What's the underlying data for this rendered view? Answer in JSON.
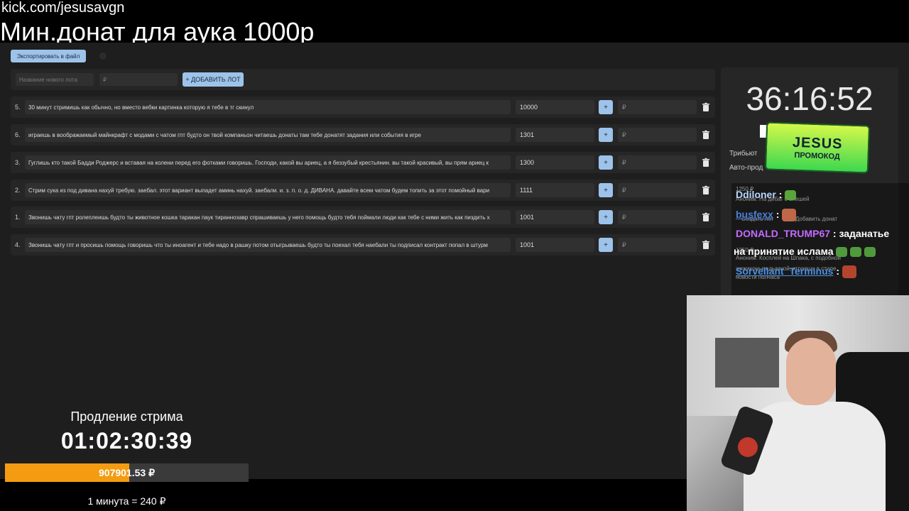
{
  "overlay": {
    "url": "kick.com/jesusavgn",
    "title": "Мин.донат для аука 1000р"
  },
  "toolbar": {
    "export_label": "Экспортировать в файл"
  },
  "new_lot": {
    "name_placeholder": "Название нового лота",
    "amount_placeholder": "₽",
    "add_label": "+ ДОБАВИТЬ ЛОТ"
  },
  "lots": [
    {
      "num": "5.",
      "name": "30 минут стримишь как обычно, но вместо вебки картинка которую я тебе в тг скинул",
      "amount": "10000",
      "plus": "+",
      "rub": "₽"
    },
    {
      "num": "6.",
      "name": "играешь в воображаемый майнкрафт с модами с чатом гпт будто он твой компаньон читаешь донаты там тебе донатят задания или события в игре",
      "amount": "1301",
      "plus": "+",
      "rub": "₽"
    },
    {
      "num": "3.",
      "name": "Гуглишь кто такой Бадди Роджерс и вставая на колени перед его фотками говоришь. Господи, какой вы ариец, а я беззубый крестьянин. вы такой красивый, вы прям ариец к",
      "amount": "1300",
      "plus": "+",
      "rub": "₽"
    },
    {
      "num": "2.",
      "name": "Стрим сука из под дивана нахуй требую. заебал. этот вариант выпадет аминь нахуй. заебали. и. з. п. о. д. ДИВАНА. давайте всем чатом будем топить за этот помойный вари",
      "amount": "1111",
      "plus": "+",
      "rub": "₽"
    },
    {
      "num": "1.",
      "name": "Звонишь чату гпт ролеплеишь будто ты животное кошка таракан паук тираннозавр спрашиваешь у него помощь будто тебя поймали люди как тебе с ними жить как пиздить х",
      "amount": "1001",
      "plus": "+",
      "rub": "₽"
    },
    {
      "num": "4.",
      "name": "Звонишь чату гпт и просишь помощь говоришь что ты иноагент и тебе надо в рашку потом отыгрываешь будто ты поехал тебя наебали ты подписал контракт попал в штурм",
      "amount": "1001",
      "plus": "+",
      "rub": "₽"
    }
  ],
  "timer": {
    "value": "36:16:52",
    "tribute_label": "Трибьют",
    "auto_label": "Авто-прод"
  },
  "promo": {
    "brand": "JESUS",
    "label": "ПРОМОКОД"
  },
  "chat": {
    "under": [
      "1250 ₽",
      "Аноним: На дебаг с олешей",
      "Создать лот",
      "Добавить донат",
      "1250 ₽",
      "Аноним: Косплей на Шпака, с подобной",
      "жижиконьки дымной, играешь в стиле",
      "новости полчаса"
    ],
    "messages": [
      {
        "user": "Ddiloner",
        "sep": " :",
        "text": ""
      },
      {
        "user": "busfexx",
        "sep": " :",
        "text": ""
      },
      {
        "user": "DONALD_TRUMP67",
        "sep": " :",
        "text": " заданатье"
      },
      {
        "user": "",
        "sep": "",
        "text": "на принятие ислама"
      },
      {
        "user": "Sorvellant_Terminus",
        "sep": " :",
        "text": ""
      }
    ],
    "colors": {
      "ddiloner": "#b7d6ff",
      "busfexx": "#4a7fd4",
      "trump": "#c36bff",
      "sorvellant": "#4a8fe0"
    }
  },
  "extension": {
    "label": "Продление стрима",
    "time": "01:02:30:39",
    "amount": "907901.53 ₽",
    "progress": 0.51,
    "rate": "1 минута = 240 ₽"
  },
  "colors": {
    "accent": "#9ec3ea",
    "bar": "#f39c12",
    "panel": "#262626",
    "bg": "#1e1e1e"
  },
  "icons": [
    "trash-icon",
    "plus-icon",
    "emote-icon"
  ]
}
